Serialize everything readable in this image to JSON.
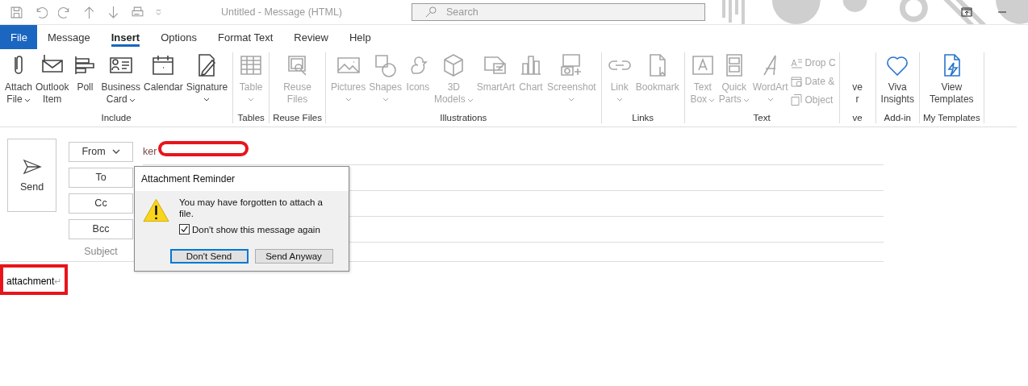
{
  "window": {
    "title": "Untitled  -  Message (HTML)"
  },
  "search": {
    "placeholder": "Search"
  },
  "tabs": [
    {
      "label": "File",
      "selected": false,
      "kind": "file"
    },
    {
      "label": "Message",
      "selected": false,
      "kind": "tab"
    },
    {
      "label": "Insert",
      "selected": true,
      "kind": "tab"
    },
    {
      "label": "Options",
      "selected": false,
      "kind": "tab"
    },
    {
      "label": "Format Text",
      "selected": false,
      "kind": "tab"
    },
    {
      "label": "Review",
      "selected": false,
      "kind": "tab"
    },
    {
      "label": "Help",
      "selected": false,
      "kind": "tab"
    }
  ],
  "ribbon": {
    "groups": [
      {
        "label": "Include",
        "items": [
          {
            "kind": "large",
            "lines": [
              "Attach",
              "File"
            ],
            "dropdown": true,
            "disabled": false
          },
          {
            "kind": "large",
            "lines": [
              "Outlook",
              "Item"
            ],
            "dropdown": false,
            "disabled": false
          },
          {
            "kind": "large",
            "lines": [
              "Poll"
            ],
            "dropdown": false,
            "disabled": false
          },
          {
            "kind": "large",
            "lines": [
              "Business",
              "Card"
            ],
            "dropdown": true,
            "disabled": false
          },
          {
            "kind": "large",
            "lines": [
              "Calendar"
            ],
            "dropdown": false,
            "disabled": false
          },
          {
            "kind": "large",
            "lines": [
              "Signature"
            ],
            "dropdown": true,
            "disabled": false
          }
        ]
      },
      {
        "label": "Tables",
        "items": [
          {
            "kind": "large",
            "lines": [
              "Table"
            ],
            "dropdown": true,
            "disabled": true
          }
        ]
      },
      {
        "label": "Reuse Files",
        "items": [
          {
            "kind": "large",
            "lines": [
              "Reuse",
              "Files"
            ],
            "dropdown": false,
            "disabled": true
          }
        ]
      },
      {
        "label": "Illustrations",
        "items": [
          {
            "kind": "large",
            "lines": [
              "Pictures"
            ],
            "dropdown": true,
            "disabled": true
          },
          {
            "kind": "large",
            "lines": [
              "Shapes"
            ],
            "dropdown": true,
            "disabled": true
          },
          {
            "kind": "large",
            "lines": [
              "Icons"
            ],
            "dropdown": false,
            "disabled": true
          },
          {
            "kind": "large",
            "lines": [
              "3D",
              "Models"
            ],
            "dropdown": true,
            "disabled": true
          },
          {
            "kind": "large",
            "lines": [
              "SmartArt"
            ],
            "dropdown": false,
            "disabled": true
          },
          {
            "kind": "large",
            "lines": [
              "Chart"
            ],
            "dropdown": false,
            "disabled": true
          },
          {
            "kind": "large",
            "lines": [
              "Screenshot"
            ],
            "dropdown": true,
            "disabled": true
          }
        ]
      },
      {
        "label": "Links",
        "items": [
          {
            "kind": "large",
            "lines": [
              "Link"
            ],
            "dropdown": true,
            "disabled": true
          },
          {
            "kind": "large",
            "lines": [
              "Bookmark"
            ],
            "dropdown": false,
            "disabled": true
          }
        ]
      },
      {
        "label": "Text",
        "items": [
          {
            "kind": "large",
            "lines": [
              "Text",
              "Box"
            ],
            "dropdown": true,
            "disabled": true
          },
          {
            "kind": "large",
            "lines": [
              "Quick",
              "Parts"
            ],
            "dropdown": true,
            "disabled": true
          },
          {
            "kind": "large",
            "lines": [
              "WordArt"
            ],
            "dropdown": true,
            "disabled": true
          },
          {
            "kind": "small",
            "lines": [
              "Drop C"
            ],
            "disabled": true
          },
          {
            "kind": "small",
            "lines": [
              "Date &"
            ],
            "disabled": true
          },
          {
            "kind": "small",
            "lines": [
              "Object"
            ],
            "disabled": true
          }
        ]
      },
      {
        "label": "ve",
        "items": [
          {
            "kind": "large",
            "lines": [
              "ve",
              "r"
            ],
            "dropdown": false,
            "disabled": false
          }
        ]
      },
      {
        "label": "Add-in",
        "items": [
          {
            "kind": "large",
            "lines": [
              "Viva",
              "Insights"
            ],
            "dropdown": false,
            "disabled": false
          }
        ]
      },
      {
        "label": "My Templates",
        "items": [
          {
            "kind": "large",
            "lines": [
              "View",
              "Templates"
            ],
            "dropdown": false,
            "disabled": false
          }
        ]
      }
    ]
  },
  "compose": {
    "send": {
      "label": "Send"
    },
    "fields": [
      {
        "kind": "button",
        "label": "From",
        "dropdown": true,
        "value": "ker"
      },
      {
        "kind": "button",
        "label": "To",
        "dropdown": false
      },
      {
        "kind": "button",
        "label": "Cc",
        "dropdown": false
      },
      {
        "kind": "button",
        "label": "Bcc",
        "dropdown": false
      },
      {
        "kind": "label",
        "label": "Subject"
      }
    ],
    "body": {
      "text": "attachment",
      "mark": "↵"
    }
  },
  "dialog": {
    "title": "Attachment Reminder",
    "message": "You may have forgotten to attach a file.",
    "checkbox": {
      "label": "Don't show this message again",
      "checked": true
    },
    "buttons": [
      {
        "label": "Don't Send",
        "default": true
      },
      {
        "label": "Send Anyway",
        "default": false
      }
    ]
  }
}
